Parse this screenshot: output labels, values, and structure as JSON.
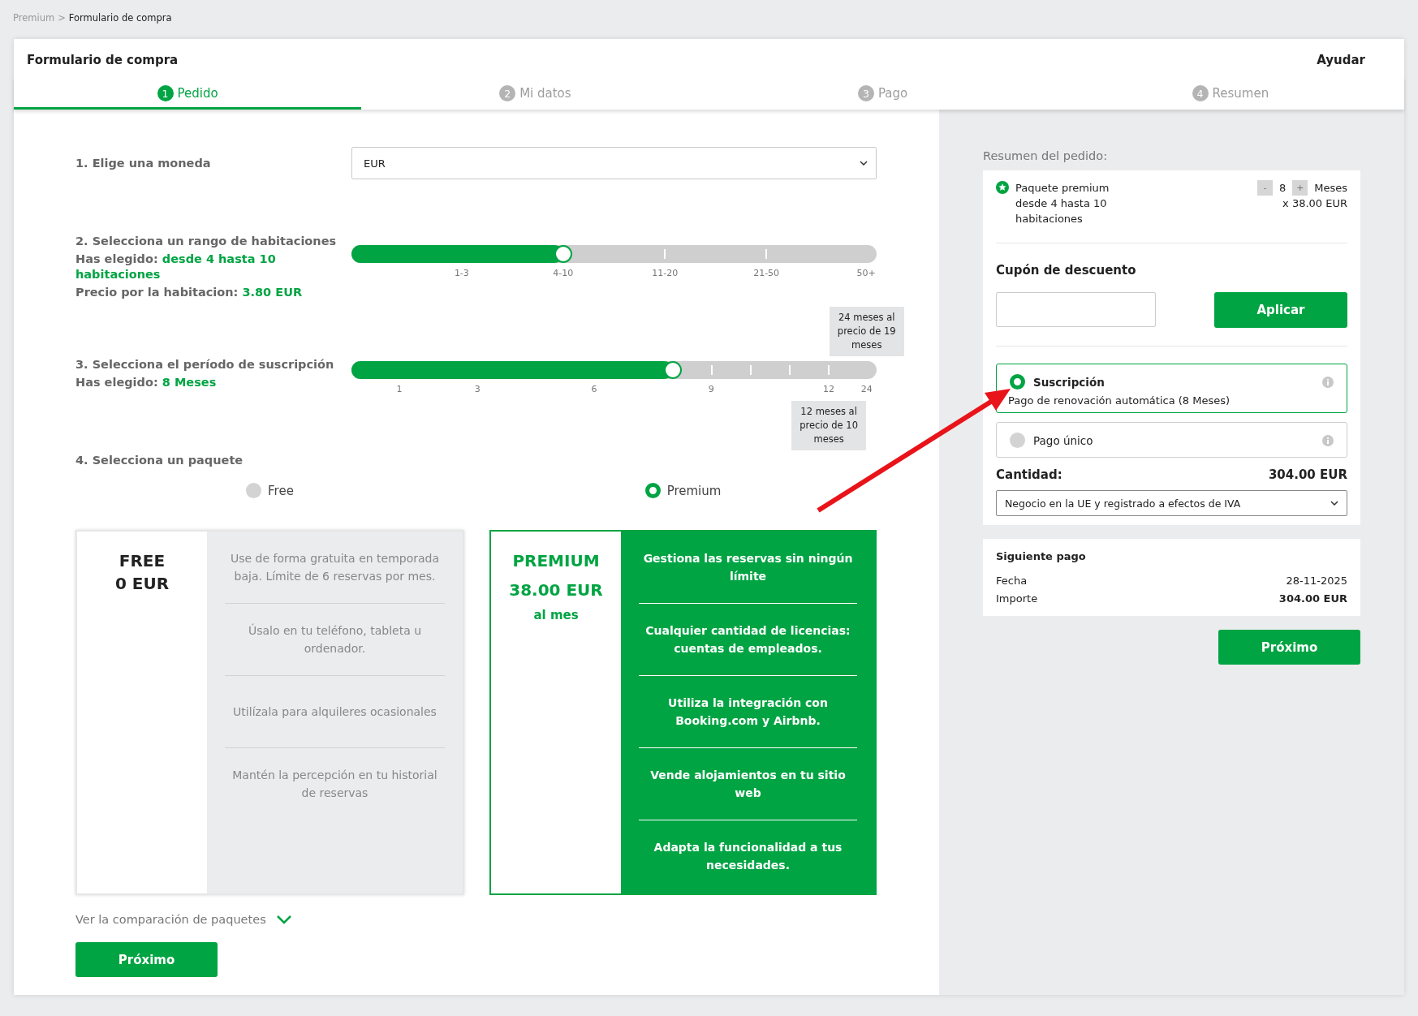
{
  "breadcrumb": {
    "items": [
      {
        "label": "Premium",
        "current": false
      },
      {
        "label": "Formulario de compra",
        "current": true
      }
    ],
    "separator": ">"
  },
  "header": {
    "title": "Formulario de compra",
    "help": "Ayudar"
  },
  "tabs": [
    {
      "number": "1",
      "label": "Pedido",
      "selected": true
    },
    {
      "number": "2",
      "label": "Mi datos",
      "selected": false
    },
    {
      "number": "3",
      "label": "Pago",
      "selected": false
    },
    {
      "number": "4",
      "label": "Resumen",
      "selected": false
    }
  ],
  "steps": [
    {
      "kind": "select",
      "title": "1. Elige una moneda",
      "value": "EUR"
    },
    {
      "kind": "slider",
      "title": "2. Selecciona un rango de habitaciones",
      "lines": [
        {
          "label": "Has elegido:",
          "value": "desde 4 hasta 10 habitaciones"
        },
        {
          "label": "Precio por la habitacion:",
          "value": "3.80 EUR"
        }
      ],
      "level": 0.403,
      "ticks": [
        {
          "label": "1-3"
        },
        {
          "label": "4-10"
        },
        {
          "label": "11-20"
        },
        {
          "label": "21-50"
        },
        {
          "label": "50+"
        }
      ]
    },
    {
      "kind": "slider",
      "title": "3. Selecciona el período de suscripción",
      "lines": [
        {
          "label": "Has elegido:",
          "value": "8 Meses"
        }
      ],
      "level": 0.612,
      "ticks": [
        {
          "label": "1"
        },
        {
          "label": "3"
        },
        {
          "label": "6"
        },
        {
          "label": "9"
        },
        {
          "label": "12",
          "note": "12 meses al precio de 10 meses"
        },
        {
          "label": "24",
          "note": "24 meses al precio de 19 meses"
        }
      ]
    },
    {
      "kind": "packages",
      "title": "4. Selecciona un paquete",
      "packages": [
        {
          "radio_label": "Free",
          "name": "FREE",
          "price": "0 EUR",
          "selected": false,
          "features": [
            "Use de forma gratuita en temporada baja. Límite de 6 reservas por mes.",
            "Úsalo en tu teléfono, tableta u ordenador.",
            "Utilízala para alquileres ocasionales",
            "Mantén la percepción en tu historial de reservas"
          ]
        },
        {
          "radio_label": "Premium",
          "name": "PREMIUM",
          "price": "38.00 EUR",
          "period": "al mes",
          "selected": true,
          "features": [
            "Gestiona las reservas sin ningún límite",
            "Cualquier cantidad de licencias: cuentas de empleados.",
            "Utiliza la integración con Booking.com y Airbnb.",
            "Vende alojamientos en tu sitio web",
            "Adapta la funcionalidad a tus necesidades."
          ]
        }
      ]
    }
  ],
  "compare_link": "Ver la comparación de paquetes",
  "next_button": "Próximo",
  "summary": {
    "title": "Resumen del pedido:",
    "item": {
      "name": "Paquete premium desde 4 hasta 10 habitaciones",
      "decrement": "-",
      "quantity": "8",
      "increment": "+",
      "unit": "Meses",
      "unit_price": "x 38.00 EUR"
    },
    "coupon": {
      "title": "Cupón de descuento",
      "button": "Aplicar"
    },
    "payment_options": [
      {
        "label": "Suscripción",
        "description": "Pago de renovación automática (8 Meses)",
        "selected": true
      },
      {
        "label": "Pago único",
        "selected": false
      }
    ],
    "amount": {
      "label": "Cantidad:",
      "value": "304.00 EUR"
    },
    "tax_status": "Negocio en la UE y registrado a efectos de IVA",
    "next_payment": {
      "title": "Siguiente pago",
      "rows": [
        {
          "label": "Fecha",
          "value": "28-11-2025",
          "emphasis": false
        },
        {
          "label": "Importe",
          "value": "304.00 EUR",
          "emphasis": true
        }
      ]
    },
    "next_button": "Próximo"
  }
}
